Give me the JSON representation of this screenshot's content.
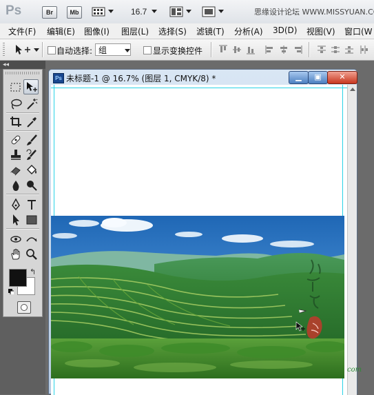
{
  "appbar": {
    "logo": "Ps",
    "bridge_label": "Br",
    "minibridge_label": "Mb",
    "zoom": "16.7",
    "watermark": "思缘设计论坛 WWW.MISSYUAN.COM"
  },
  "menubar": {
    "items": [
      "文件(F)",
      "编辑(E)",
      "图像(I)",
      "图层(L)",
      "选择(S)",
      "滤镜(T)",
      "分析(A)",
      "3D(D)",
      "视图(V)",
      "窗口(W"
    ]
  },
  "options": {
    "auto_select_label": "自动选择:",
    "auto_select_checked": false,
    "auto_select_value": "组",
    "show_transform_label": "显示变换控件",
    "show_transform_checked": false
  },
  "toolbox": {
    "tools": [
      "marquee",
      "move",
      "lasso",
      "quick-select",
      "crop",
      "eyedropper",
      "healing-brush",
      "brush",
      "clone-stamp",
      "history-brush",
      "eraser",
      "paint-bucket",
      "blur",
      "dodge",
      "pen",
      "type",
      "path-select",
      "rectangle",
      "3d-rotate",
      "3d-orbit",
      "hand",
      "zoom"
    ],
    "active_tool": "move",
    "foreground_color": "#111111",
    "background_color": "#ffffff"
  },
  "document": {
    "title": "未标题-1 @ 16.7% (图层 1, CMYK/8) *",
    "icon_label": "Ps"
  },
  "corner_watermark": "com",
  "colors": {
    "workspace": "#6b6b6b",
    "guide": "#27d3e6",
    "close_button": "#c8371f"
  }
}
